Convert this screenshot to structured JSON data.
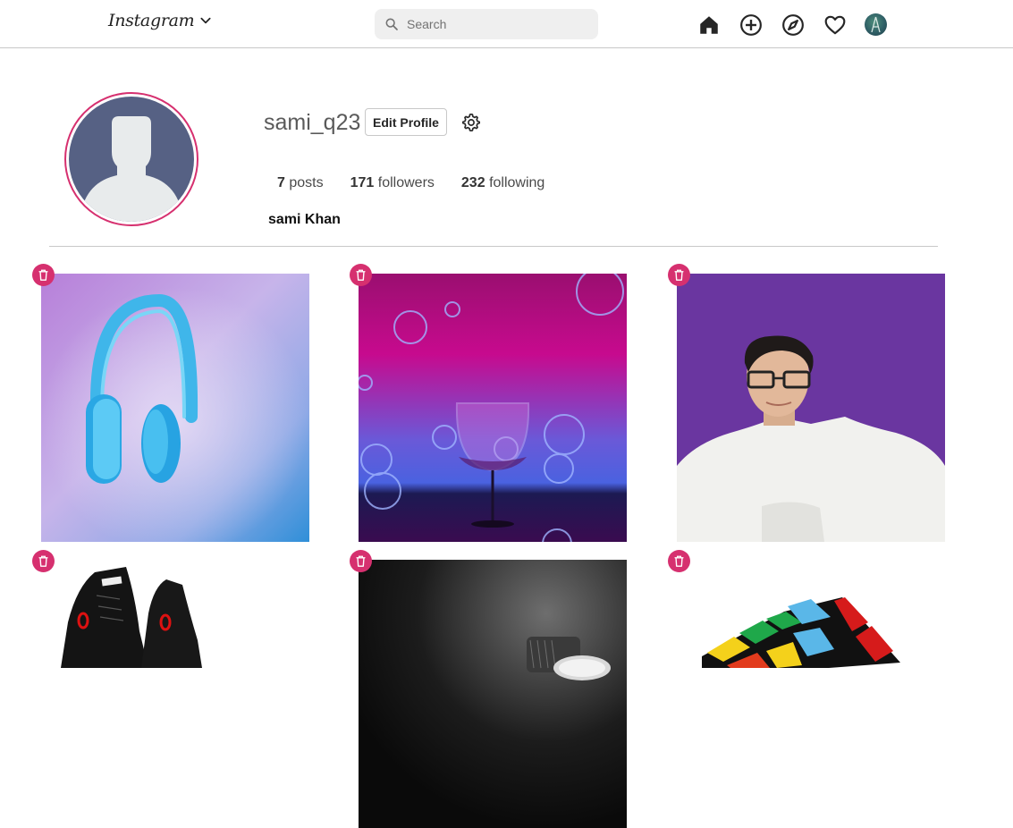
{
  "header": {
    "brand": "Instagram",
    "search": {
      "placeholder": "Search",
      "value": ""
    },
    "nav": [
      "home-icon",
      "new-post-icon",
      "explore-icon",
      "activity-heart-icon",
      "profile-avatar"
    ]
  },
  "profile": {
    "username": "sami_q23",
    "edit_label": "Edit Profile",
    "posts_count": "7",
    "posts_label": "posts",
    "followers_count": "171",
    "followers_label": "followers",
    "following_count": "232",
    "following_label": "following",
    "full_name": "sami Khan"
  },
  "posts": [
    {
      "subject": "blue headphones",
      "icon": "trash-icon"
    },
    {
      "subject": "wine glass with bubbles",
      "icon": "trash-icon"
    },
    {
      "subject": "portrait of man",
      "icon": "trash-icon"
    },
    {
      "subject": "black sneakers",
      "icon": "trash-icon"
    },
    {
      "subject": "wristwatch",
      "icon": "trash-icon"
    },
    {
      "subject": "rubik's cube",
      "icon": "trash-icon"
    }
  ],
  "colors": {
    "accent": "#d6306f",
    "avatar_bg": "#566184",
    "divider": "#c8c8c8"
  }
}
